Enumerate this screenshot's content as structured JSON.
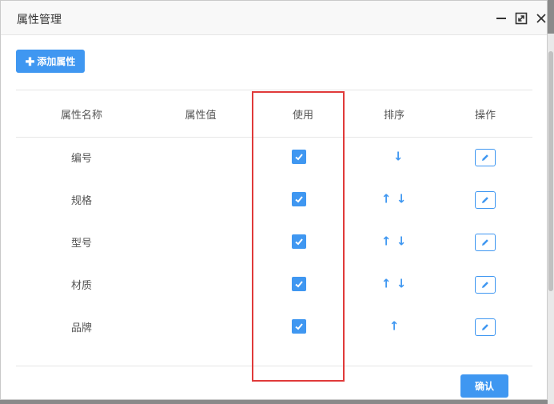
{
  "dialog": {
    "title": "属性管理",
    "add_button_label": "添加属性",
    "confirm_button_label": "确认"
  },
  "table": {
    "headers": [
      "属性名称",
      "属性值",
      "使用",
      "排序",
      "操作"
    ],
    "rows": [
      {
        "name": "编号",
        "value": "",
        "used": true,
        "sort": [
          "down"
        ]
      },
      {
        "name": "规格",
        "value": "",
        "used": true,
        "sort": [
          "up",
          "down"
        ]
      },
      {
        "name": "型号",
        "value": "",
        "used": true,
        "sort": [
          "up",
          "down"
        ]
      },
      {
        "name": "材质",
        "value": "",
        "used": true,
        "sort": [
          "up",
          "down"
        ]
      },
      {
        "name": "品牌",
        "value": "",
        "used": true,
        "sort": [
          "up"
        ]
      }
    ]
  },
  "icons": {
    "add": "plus-icon",
    "minimize": "minimize-icon",
    "maximize": "maximize-icon",
    "close": "close-icon",
    "check": "check-icon",
    "sort_up": "arrow-up-icon",
    "sort_down": "arrow-down-icon",
    "edit": "pencil-icon"
  },
  "colors": {
    "accent": "#3f97f1",
    "highlight": "#e03a3a",
    "text": "#555555"
  }
}
